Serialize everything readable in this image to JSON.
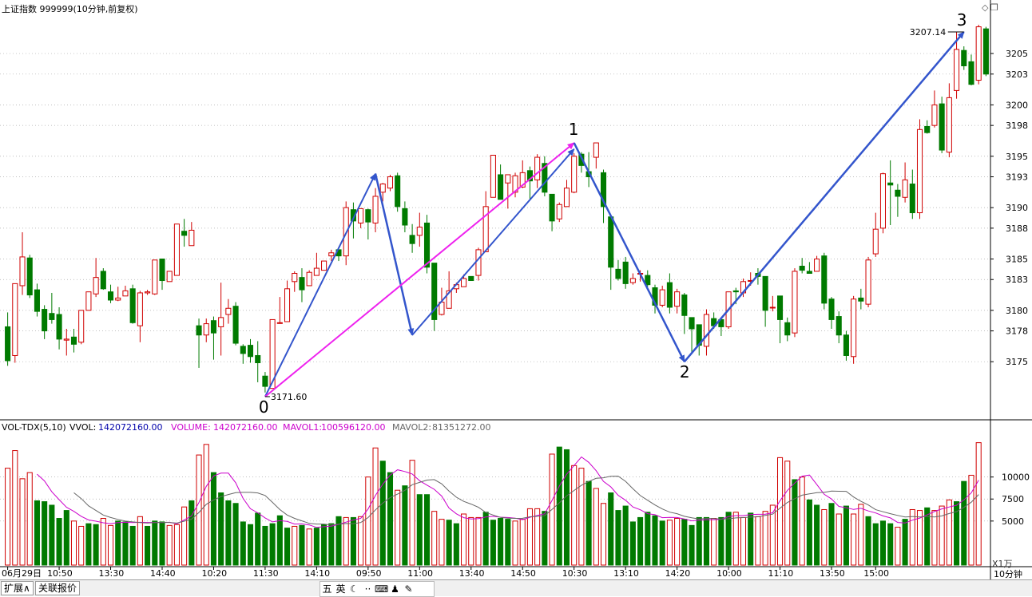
{
  "header": {
    "title": "上证指数 999999(10分钟,前复权)"
  },
  "volume_header": {
    "indicator": "VOL-TDX(5,10)",
    "vvol_label": "VVOL:",
    "vvol_value": "142072160.00",
    "volume_label": "VOLUME:",
    "volume_value": "142072160.00",
    "mavol1_label": "MAVOL1:",
    "mavol1_value": "100596120.00",
    "mavol2_label": "MAVOL2:",
    "mavol2_value": "81351272.00"
  },
  "colors": {
    "up": "#d00000",
    "down": "#007a00",
    "ma1": "#cc00cc",
    "ma2": "#666666",
    "arrow": "#3355cc",
    "arrow_main": "#ee22ee"
  },
  "annotations": {
    "low_label": "3171.60",
    "high_label": "3207.14",
    "wave_labels": [
      "0",
      "1",
      "2",
      "3"
    ]
  },
  "time_labels": [
    "06月29日",
    "10:50",
    "13:30",
    "14:40",
    "10:20",
    "11:30",
    "14:10",
    "09:50",
    "11:00",
    "13:40",
    "14:50",
    "10:30",
    "13:10",
    "14:20",
    "10:00",
    "11:10",
    "13:50",
    "15:00"
  ],
  "period_label": "10分钟",
  "volume_unit": "X1万",
  "bottom_tabs": [
    "扩展∧",
    "关联报价"
  ],
  "ime_icons": [
    "五",
    "英",
    "☾",
    "··",
    "⌨",
    "♟",
    "✎"
  ],
  "chart_data": {
    "type": "candlestick",
    "title": "上证指数 999999(10分钟,前复权)",
    "price_axis": {
      "ticks": [
        3175,
        3178,
        3180,
        3183,
        3185,
        3188,
        3190,
        3193,
        3195,
        3198,
        3200,
        3203,
        3205
      ],
      "range": [
        3169.5,
        3208.5
      ]
    },
    "volume_axis": {
      "ticks": [
        5000,
        7500,
        10000
      ],
      "range": [
        0,
        14500
      ]
    },
    "candles": [
      [
        3178.4,
        3175.1,
        3179.8,
        3174.6
      ],
      [
        3175.6,
        3182.6,
        3182.6,
        3174.9
      ],
      [
        3182.4,
        3185.2,
        3187.6,
        3181.5
      ],
      [
        3185.1,
        3181.5,
        3185.4,
        3181.2
      ],
      [
        3182.0,
        3179.9,
        3182.6,
        3179.4
      ],
      [
        3180.1,
        3178.0,
        3180.5,
        3177.2
      ],
      [
        3179.7,
        3179.1,
        3181.7,
        3178.7
      ],
      [
        3179.6,
        3177.2,
        3180.3,
        3176.2
      ],
      [
        3177.1,
        3177.2,
        3178.2,
        3175.6
      ],
      [
        3177.4,
        3176.7,
        3178.2,
        3175.9
      ],
      [
        3176.9,
        3180.0,
        3180.0,
        3176.7
      ],
      [
        3180.0,
        3181.8,
        3181.8,
        3180.3
      ],
      [
        3181.6,
        3183.2,
        3185.1,
        3181.3
      ],
      [
        3183.8,
        3182.1,
        3184.1,
        3182.0
      ],
      [
        3181.8,
        3181.0,
        3182.5,
        3180.7
      ],
      [
        3181.0,
        3181.2,
        3182.3,
        3180.9
      ],
      [
        3181.4,
        3181.9,
        3182.4,
        3181.6
      ],
      [
        3182.1,
        3178.8,
        3182.5,
        3178.7
      ],
      [
        3178.5,
        3181.7,
        3181.9,
        3176.9
      ],
      [
        3181.7,
        3181.8,
        3182.0,
        3181.5
      ],
      [
        3181.6,
        3184.9,
        3184.9,
        3181.5
      ],
      [
        3185.0,
        3182.9,
        3184.7,
        3182.0
      ],
      [
        3182.8,
        3183.8,
        3183.7,
        3183.8
      ],
      [
        3183.4,
        3188.4,
        3188.4,
        3183.4
      ],
      [
        3187.7,
        3187.3,
        3188.9,
        3186.2
      ],
      [
        3186.3,
        3187.8,
        3188.6,
        3186.3
      ],
      [
        3178.5,
        3177.6,
        3179.2,
        3174.4
      ],
      [
        3177.6,
        3178.7,
        3179.2,
        3176.9
      ],
      [
        3179.0,
        3177.8,
        3179.4,
        3175.2
      ],
      [
        3178.4,
        3179.3,
        3182.7,
        3175.6
      ],
      [
        3179.6,
        3180.2,
        3181.1,
        3178.7
      ],
      [
        3180.4,
        3176.8,
        3180.8,
        3176.6
      ],
      [
        3176.5,
        3175.8,
        3176.7,
        3174.8
      ],
      [
        3176.6,
        3175.5,
        3177.2,
        3174.9
      ],
      [
        3175.6,
        3174.9,
        3177.0,
        3173.0
      ],
      [
        3173.6,
        3172.6,
        3174.0,
        3172.0
      ],
      [
        3172.4,
        3179.1,
        3179.1,
        3172.4
      ],
      [
        3178.8,
        3178.8,
        3181.3,
        3178.7
      ],
      [
        3178.9,
        3182.1,
        3182.9,
        3178.9
      ],
      [
        3182.8,
        3183.6,
        3183.8,
        3181.8
      ],
      [
        3183.2,
        3182.0,
        3184.1,
        3180.8
      ],
      [
        3182.4,
        3183.7,
        3183.9,
        3183.4
      ],
      [
        3183.4,
        3184.1,
        3185.6,
        3183.4
      ],
      [
        3183.9,
        3184.8,
        3184.8,
        3183.9
      ],
      [
        3185.3,
        3185.6,
        3185.9,
        3184.8
      ],
      [
        3185.9,
        3185.3,
        3185.7,
        3184.8
      ],
      [
        3185.3,
        3190.0,
        3190.6,
        3184.4
      ],
      [
        3189.8,
        3188.7,
        3190.5,
        3187.0
      ],
      [
        3188.5,
        3189.9,
        3189.9,
        3188.0
      ],
      [
        3189.8,
        3188.6,
        3189.9,
        3186.9
      ],
      [
        3188.5,
        3191.1,
        3191.9,
        3187.6
      ],
      [
        3191.5,
        3192.3,
        3192.4,
        3190.6
      ],
      [
        3191.9,
        3193.0,
        3193.2,
        3191.6
      ],
      [
        3193.1,
        3190.1,
        3193.4,
        3189.6
      ],
      [
        3189.9,
        3188.3,
        3190.6,
        3187.6
      ],
      [
        3187.3,
        3186.5,
        3188.4,
        3185.6
      ],
      [
        3187.3,
        3188.1,
        3189.5,
        3186.2
      ],
      [
        3188.5,
        3184.2,
        3189.3,
        3183.6
      ],
      [
        3184.6,
        3179.1,
        3184.3,
        3178.0
      ],
      [
        3179.6,
        3180.8,
        3182.2,
        3179.5
      ],
      [
        3180.2,
        3181.9,
        3183.8,
        3180.5
      ],
      [
        3182.1,
        3182.5,
        3182.7,
        3181.7
      ],
      [
        3182.3,
        3183.1,
        3183.5,
        3182.3
      ],
      [
        3183.3,
        3182.9,
        3183.3,
        3182.9
      ],
      [
        3183.4,
        3185.9,
        3186.1,
        3182.9
      ],
      [
        3185.7,
        3190.1,
        3191.6,
        3185.7
      ],
      [
        3191.0,
        3195.1,
        3195.0,
        3191.0
      ],
      [
        3193.2,
        3190.8,
        3194.2,
        3192.4
      ],
      [
        3192.4,
        3193.2,
        3193.2,
        3189.9
      ],
      [
        3191.5,
        3193.1,
        3193.4,
        3191.0
      ],
      [
        3192.0,
        3193.4,
        3194.6,
        3191.9
      ],
      [
        3193.6,
        3192.6,
        3194.0,
        3190.7
      ],
      [
        3192.7,
        3194.9,
        3195.2,
        3191.9
      ],
      [
        3194.3,
        3191.5,
        3195.0,
        3191.1
      ],
      [
        3191.3,
        3188.7,
        3191.2,
        3187.7
      ],
      [
        3188.9,
        3190.3,
        3190.5,
        3188.6
      ],
      [
        3190.1,
        3191.9,
        3192.7,
        3191.9
      ],
      [
        3191.5,
        3195.0,
        3195.3,
        3191.4
      ],
      [
        3195.2,
        3194.1,
        3195.4,
        3193.4
      ],
      [
        3193.5,
        3193.0,
        3195.4,
        3192.0
      ],
      [
        3194.9,
        3196.3,
        3196.3,
        3193.8
      ],
      [
        3193.4,
        3190.1,
        3193.7,
        3188.5
      ],
      [
        3189.1,
        3184.2,
        3189.1,
        3182.0
      ],
      [
        3184.0,
        3183.1,
        3184.9,
        3182.9
      ],
      [
        3184.7,
        3182.6,
        3185.2,
        3182.1
      ],
      [
        3182.7,
        3183.1,
        3183.6,
        3182.5
      ],
      [
        3183.6,
        3183.6,
        3183.9,
        3182.8
      ],
      [
        3183.4,
        3182.5,
        3183.9,
        3182.3
      ],
      [
        3182.2,
        3180.5,
        3182.5,
        3179.7
      ],
      [
        3180.5,
        3182.0,
        3182.4,
        3180.3
      ],
      [
        3182.7,
        3180.3,
        3183.6,
        3179.7
      ],
      [
        3180.4,
        3181.8,
        3182.1,
        3179.7
      ],
      [
        3181.5,
        3179.5,
        3181.7,
        3177.7
      ],
      [
        3179.3,
        3178.2,
        3179.3,
        3175.9
      ],
      [
        3178.6,
        3176.6,
        3178.5,
        3175.6
      ],
      [
        3176.5,
        3179.6,
        3180.1,
        3175.6
      ],
      [
        3179.2,
        3178.5,
        3179.8,
        3178.2
      ],
      [
        3179.1,
        3178.4,
        3179.3,
        3177.5
      ],
      [
        3178.4,
        3181.8,
        3181.8,
        3178.2
      ],
      [
        3181.9,
        3181.8,
        3182.2,
        3180.6
      ],
      [
        3181.7,
        3182.8,
        3183.1,
        3181.3
      ],
      [
        3182.9,
        3182.9,
        3183.7,
        3182.4
      ],
      [
        3183.6,
        3183.3,
        3184.1,
        3182.5
      ],
      [
        3183.3,
        3180.0,
        3182.8,
        3178.4
      ],
      [
        3180.3,
        3180.3,
        3181.4,
        3179.9
      ],
      [
        3181.4,
        3179.1,
        3181.4,
        3176.8
      ],
      [
        3178.8,
        3177.6,
        3179.3,
        3177.0
      ],
      [
        3177.8,
        3183.8,
        3184.1,
        3177.4
      ],
      [
        3184.3,
        3183.9,
        3185.1,
        3183.6
      ],
      [
        3183.8,
        3183.6,
        3184.7,
        3183.6
      ],
      [
        3183.8,
        3185.0,
        3185.3,
        3183.8
      ],
      [
        3185.3,
        3180.7,
        3185.6,
        3180.1
      ],
      [
        3181.1,
        3179.1,
        3181.3,
        3178.2
      ],
      [
        3179.4,
        3177.6,
        3179.9,
        3176.8
      ],
      [
        3177.6,
        3175.6,
        3178.0,
        3175.1
      ],
      [
        3175.5,
        3181.1,
        3181.4,
        3174.8
      ],
      [
        3181.2,
        3180.9,
        3182.1,
        3180.1
      ],
      [
        3180.6,
        3184.9,
        3185.2,
        3180.3
      ],
      [
        3185.5,
        3187.9,
        3189.5,
        3185.2
      ],
      [
        3188.0,
        3193.3,
        3193.4,
        3187.5
      ],
      [
        3192.4,
        3192.2,
        3194.6,
        3188.3
      ],
      [
        3191.7,
        3191.1,
        3192.3,
        3189.1
      ],
      [
        3191.0,
        3192.7,
        3194.4,
        3190.5
      ],
      [
        3192.3,
        3189.5,
        3193.7,
        3188.9
      ],
      [
        3189.5,
        3197.6,
        3198.6,
        3188.9
      ],
      [
        3197.9,
        3197.3,
        3198.5,
        3197.2
      ],
      [
        3198.0,
        3200.0,
        3201.4,
        3197.8
      ],
      [
        3200.1,
        3195.6,
        3200.8,
        3195.3
      ],
      [
        3195.4,
        3200.7,
        3202.1,
        3194.9
      ],
      [
        3201.4,
        3205.4,
        3207.1,
        3200.6
      ],
      [
        3205.3,
        3203.8,
        3205.7,
        3203.4
      ],
      [
        3204.2,
        3202.0,
        3204.9,
        3201.9
      ],
      [
        3202.4,
        3207.6,
        3207.8,
        3202.0
      ],
      [
        3207.4,
        3203.0,
        3207.6,
        3202.8
      ]
    ],
    "volume": [
      [
        11000,
        0
      ],
      [
        13000,
        0
      ],
      [
        9800,
        0
      ],
      [
        10500,
        0
      ],
      [
        7300,
        1
      ],
      [
        7200,
        1
      ],
      [
        6800,
        1
      ],
      [
        5300,
        1
      ],
      [
        6200,
        1
      ],
      [
        5000,
        0
      ],
      [
        4400,
        0
      ],
      [
        4700,
        1
      ],
      [
        4600,
        1
      ],
      [
        5300,
        0
      ],
      [
        4500,
        0
      ],
      [
        5000,
        1
      ],
      [
        4900,
        1
      ],
      [
        4400,
        1
      ],
      [
        5500,
        0
      ],
      [
        4400,
        1
      ],
      [
        5000,
        1
      ],
      [
        4900,
        1
      ],
      [
        4500,
        0
      ],
      [
        4600,
        0
      ],
      [
        6600,
        0
      ],
      [
        7300,
        1
      ],
      [
        12500,
        0
      ],
      [
        13700,
        0
      ],
      [
        10500,
        1
      ],
      [
        8200,
        1
      ],
      [
        7300,
        1
      ],
      [
        7000,
        1
      ],
      [
        4900,
        1
      ],
      [
        4600,
        1
      ],
      [
        5900,
        1
      ],
      [
        4400,
        1
      ],
      [
        4700,
        1
      ],
      [
        5600,
        1
      ],
      [
        4200,
        1
      ],
      [
        4400,
        0
      ],
      [
        4500,
        1
      ],
      [
        4100,
        0
      ],
      [
        4200,
        1
      ],
      [
        4600,
        1
      ],
      [
        4700,
        1
      ],
      [
        5500,
        1
      ],
      [
        5400,
        0
      ],
      [
        5400,
        1
      ],
      [
        5500,
        0
      ],
      [
        10000,
        0
      ],
      [
        13300,
        0
      ],
      [
        11800,
        1
      ],
      [
        10500,
        1
      ],
      [
        8500,
        0
      ],
      [
        9000,
        1
      ],
      [
        11900,
        0
      ],
      [
        8000,
        1
      ],
      [
        8000,
        1
      ],
      [
        6100,
        0
      ],
      [
        5200,
        0
      ],
      [
        5100,
        1
      ],
      [
        4700,
        1
      ],
      [
        5800,
        0
      ],
      [
        5400,
        0
      ],
      [
        5400,
        0
      ],
      [
        6000,
        1
      ],
      [
        5100,
        1
      ],
      [
        5300,
        1
      ],
      [
        5200,
        1
      ],
      [
        5000,
        0
      ],
      [
        5200,
        0
      ],
      [
        6400,
        0
      ],
      [
        6400,
        0
      ],
      [
        6100,
        1
      ],
      [
        12600,
        0
      ],
      [
        13400,
        1
      ],
      [
        13100,
        1
      ],
      [
        11300,
        0
      ],
      [
        11000,
        0
      ],
      [
        9500,
        1
      ],
      [
        8700,
        0
      ],
      [
        7000,
        0
      ],
      [
        8200,
        1
      ],
      [
        6200,
        1
      ],
      [
        6700,
        1
      ],
      [
        4900,
        1
      ],
      [
        5400,
        1
      ],
      [
        6000,
        1
      ],
      [
        5600,
        1
      ],
      [
        5000,
        1
      ],
      [
        5100,
        0
      ],
      [
        5300,
        0
      ],
      [
        5200,
        1
      ],
      [
        4500,
        1
      ],
      [
        5400,
        1
      ],
      [
        5400,
        1
      ],
      [
        5300,
        0
      ],
      [
        5400,
        1
      ],
      [
        6000,
        1
      ],
      [
        6000,
        0
      ],
      [
        5400,
        0
      ],
      [
        5900,
        1
      ],
      [
        5500,
        0
      ],
      [
        6100,
        0
      ],
      [
        6800,
        0
      ],
      [
        12200,
        0
      ],
      [
        11800,
        0
      ],
      [
        9700,
        1
      ],
      [
        10000,
        0
      ],
      [
        7400,
        1
      ],
      [
        6800,
        1
      ],
      [
        6300,
        0
      ],
      [
        7000,
        1
      ],
      [
        5800,
        0
      ],
      [
        6700,
        1
      ],
      [
        5800,
        0
      ],
      [
        6900,
        0
      ],
      [
        5500,
        1
      ],
      [
        4700,
        1
      ],
      [
        5000,
        1
      ],
      [
        4700,
        1
      ],
      [
        4300,
        0
      ],
      [
        5200,
        1
      ],
      [
        6300,
        0
      ],
      [
        6200,
        0
      ],
      [
        6500,
        1
      ],
      [
        6200,
        0
      ],
      [
        6700,
        0
      ],
      [
        7400,
        0
      ],
      [
        7200,
        1
      ],
      [
        9500,
        1
      ],
      [
        10200,
        0
      ],
      [
        13900,
        0
      ]
    ],
    "waves": [
      {
        "label": "0",
        "price": 3171.6
      },
      {
        "label": "1",
        "price": 3196.3
      },
      {
        "label": "2",
        "price": 3175.0
      },
      {
        "label": "3",
        "price": 3207.14
      }
    ]
  }
}
